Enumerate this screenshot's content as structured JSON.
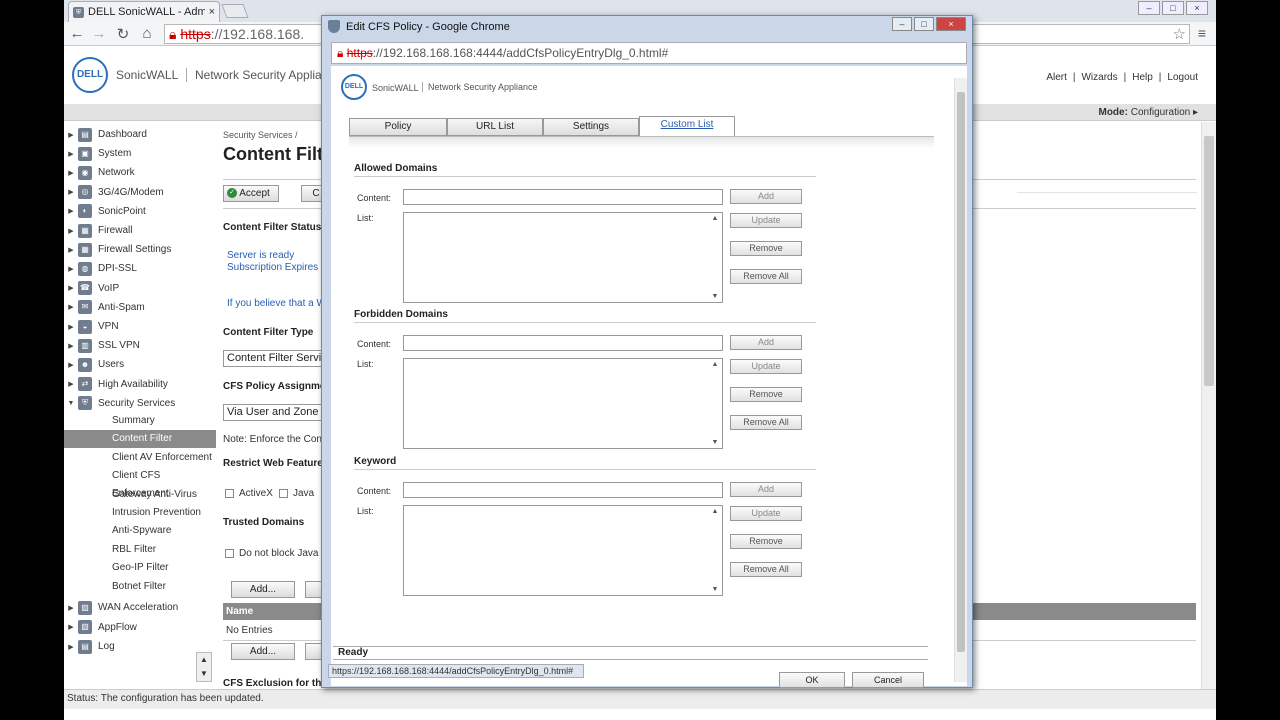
{
  "browser": {
    "tab_title": "DELL SonicWALL - Admin",
    "tab_close": "×",
    "url_scheme": "https",
    "url_rest": "://192.168.168.",
    "window_buttons": [
      "–",
      "□",
      "×"
    ]
  },
  "header": {
    "logo": "DELL",
    "brand": "SonicWALL",
    "product": "Network Security Appliance",
    "links": [
      "Alert",
      "|",
      "Wizards",
      "|",
      "Help",
      "|",
      "Logout"
    ]
  },
  "modebar": {
    "label": "Mode:",
    "value": "Configuration ▸"
  },
  "sidebar": {
    "items": [
      {
        "label": "Dashboard",
        "icon": "dashboard-icon",
        "glyph": "▤",
        "arrow": "▶"
      },
      {
        "label": "System",
        "icon": "system-icon",
        "glyph": "▣",
        "arrow": "▶"
      },
      {
        "label": "Network",
        "icon": "network-icon",
        "glyph": "◉",
        "arrow": "▶"
      },
      {
        "label": "3G/4G/Modem",
        "icon": "modem-icon",
        "glyph": "◎",
        "arrow": "▶"
      },
      {
        "label": "SonicPoint",
        "icon": "sonicpoint-icon",
        "glyph": "◐",
        "arrow": "▶"
      },
      {
        "label": "Firewall",
        "icon": "firewall-icon",
        "glyph": "▦",
        "arrow": "▶"
      },
      {
        "label": "Firewall Settings",
        "icon": "firewall-settings-icon",
        "glyph": "▦",
        "arrow": "▶"
      },
      {
        "label": "DPI-SSL",
        "icon": "dpi-ssl-icon",
        "glyph": "◍",
        "arrow": "▶"
      },
      {
        "label": "VoIP",
        "icon": "voip-icon",
        "glyph": "☎",
        "arrow": "▶"
      },
      {
        "label": "Anti-Spam",
        "icon": "anti-spam-icon",
        "glyph": "✉",
        "arrow": "▶"
      },
      {
        "label": "VPN",
        "icon": "vpn-icon",
        "glyph": "◒",
        "arrow": "▶"
      },
      {
        "label": "SSL VPN",
        "icon": "ssl-vpn-icon",
        "glyph": "▥",
        "arrow": "▶"
      },
      {
        "label": "Users",
        "icon": "users-icon",
        "glyph": "☻",
        "arrow": "▶"
      },
      {
        "label": "High Availability",
        "icon": "high-availability-icon",
        "glyph": "⇄",
        "arrow": "▶"
      },
      {
        "label": "Security Services",
        "icon": "security-services-icon",
        "glyph": "⛨",
        "arrow": "▼"
      }
    ],
    "sub_items": [
      "Summary",
      "Content Filter",
      "Client AV Enforcement",
      "Client CFS Enforcement",
      "Gateway Anti-Virus",
      "Intrusion Prevention",
      "Anti-Spyware",
      "RBL Filter",
      "Geo-IP Filter",
      "Botnet Filter"
    ],
    "active_sub": "Content Filter",
    "items_bottom": [
      {
        "label": "WAN Acceleration",
        "icon": "wan-acceleration-icon",
        "glyph": "▨",
        "arrow": "▶"
      },
      {
        "label": "AppFlow",
        "icon": "appflow-icon",
        "glyph": "▧",
        "arrow": "▶"
      },
      {
        "label": "Log",
        "icon": "log-icon",
        "glyph": "▤",
        "arrow": "▶"
      }
    ]
  },
  "content": {
    "breadcrumb": "Security Services /",
    "title": "Content Filt",
    "accept": "Accept",
    "cancel_partial": "C",
    "status_title": "Content Filter Status",
    "server_ready": "Server is ready",
    "subscription": "Subscription Expires",
    "believe": "If you believe that a W",
    "filter_type_title": "Content Filter Type",
    "filter_type_value": "Content Filter Servi",
    "policy_assign_title": "CFS Policy Assignment",
    "policy_assign_value": "Via User and Zone S",
    "note": "Note: Enforce the Conte",
    "restrict_title": "Restrict Web Feature",
    "activex": "ActiveX",
    "java": "Java",
    "trusted_title": "Trusted Domains",
    "no_block_java": "Do not block Java /",
    "add": "Add...",
    "table_header": "Name",
    "no_entries": "No Entries",
    "add2": "Add...",
    "exclusion_title": "CFS Exclusion for the"
  },
  "status": "Status: The configuration has been updated.",
  "popup": {
    "window_title": "Edit CFS Policy - Google Chrome",
    "url_scheme": "https",
    "url_rest": "://192.168.168.168:4444/addCfsPolicyEntryDlg_0.html#",
    "logo": "DELL",
    "brand": "SonicWALL",
    "product": "Network Security Appliance",
    "tabs": [
      "Policy",
      "URL List",
      "Settings",
      "Custom List"
    ],
    "active_tab": "Custom List",
    "sections": [
      {
        "title": "Allowed Domains",
        "content_label": "Content:",
        "list_label": "List:",
        "buttons": [
          "Add",
          "Update",
          "Remove",
          "Remove All"
        ]
      },
      {
        "title": "Forbidden Domains",
        "content_label": "Content:",
        "list_label": "List:",
        "buttons": [
          "Add",
          "Update",
          "Remove",
          "Remove All"
        ]
      },
      {
        "title": "Keyword",
        "content_label": "Content:",
        "list_label": "List:",
        "buttons": [
          "Add",
          "Update",
          "Remove",
          "Remove All"
        ]
      }
    ],
    "status": "Ready",
    "ok": "OK",
    "cancel": "Cancel",
    "hover_url": "https://192.168.168.168:4444/addCfsPolicyEntryDlg_0.html#"
  }
}
